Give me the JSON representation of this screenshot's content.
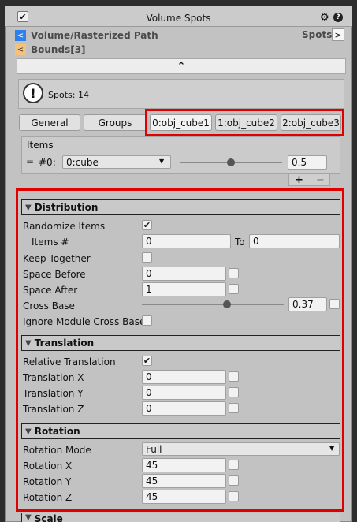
{
  "header": {
    "title": "Volume Spots",
    "enabled_check": "✔"
  },
  "nav": {
    "path_arrow": "<",
    "path": "Volume/Rasterized Path",
    "spots_link": "Spots",
    "spots_arrow": ">",
    "bounds_arrow": "<",
    "bounds": "Bounds[3]"
  },
  "collapse_glyph": "⌃",
  "info": {
    "text": "Spots: 14",
    "icon_glyph": "!"
  },
  "tabs": [
    {
      "label": "General"
    },
    {
      "label": "Groups"
    },
    {
      "label": "0:obj_cube1"
    },
    {
      "label": "1:obj_cube2"
    },
    {
      "label": "2:obj_cube3"
    }
  ],
  "items": {
    "title": "Items",
    "row_index": "#0:",
    "item_value": "0:cube",
    "weight": "0.5",
    "weight_fraction": 0.5,
    "add": "+",
    "remove": "−"
  },
  "distribution": {
    "title": "Distribution",
    "randomize_label": "Randomize Items",
    "randomize_checked": true,
    "items_num_label": "Items #",
    "items_from": "0",
    "to_label": "To",
    "items_to": "0",
    "keep_together_label": "Keep Together",
    "space_before_label": "Space Before",
    "space_before": "0",
    "space_after_label": "Space After",
    "space_after": "1",
    "cross_base_label": "Cross Base",
    "cross_base": "0.37",
    "cross_base_fraction": 0.6,
    "ignore_label": "Ignore Module Cross Base"
  },
  "translation": {
    "title": "Translation",
    "relative_label": "Relative Translation",
    "relative_checked": true,
    "x_label": "Translation X",
    "x": "0",
    "y_label": "Translation Y",
    "y": "0",
    "z_label": "Translation Z",
    "z": "0"
  },
  "rotation": {
    "title": "Rotation",
    "mode_label": "Rotation Mode",
    "mode": "Full",
    "x_label": "Rotation X",
    "x": "45",
    "y_label": "Rotation Y",
    "y": "45",
    "z_label": "Rotation Z",
    "z": "45"
  },
  "scale": {
    "title": "Scale"
  },
  "icons": [
    "checkbox-icon",
    "gear-icon",
    "help-icon",
    "warning-icon",
    "chevron-up-icon",
    "triangle-down-icon",
    "dropdown-arrow-icon",
    "drag-handle-icon"
  ]
}
